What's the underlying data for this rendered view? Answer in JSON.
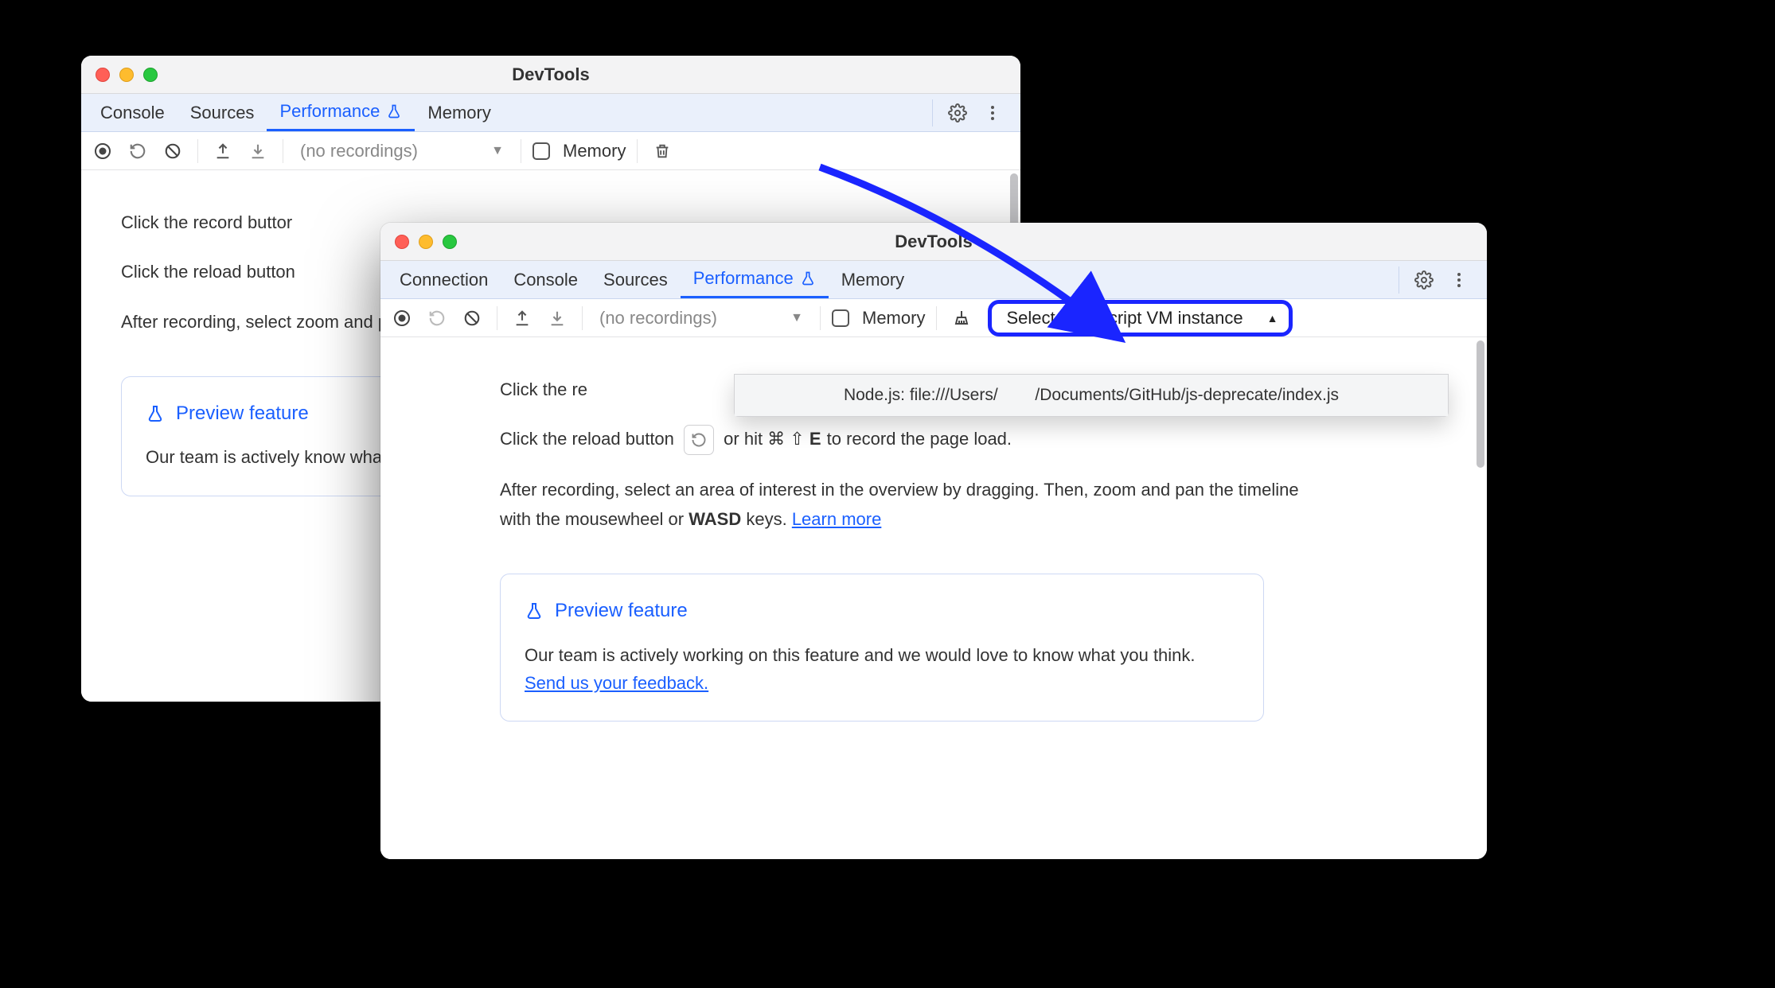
{
  "window_back": {
    "title": "DevTools",
    "tabs": [
      "Console",
      "Sources",
      "Performance",
      "Memory"
    ],
    "active_tab": "Performance",
    "toolbar": {
      "recordings_combo": "(no recordings)",
      "memory_label": "Memory"
    },
    "content": {
      "line1_prefix": "Click the record buttor",
      "line2_prefix": "Click the reload button",
      "line3": "After recording, select zoom and pan the tir",
      "preview_title": "Preview feature",
      "preview_body": "Our team is actively know what you thin"
    }
  },
  "window_front": {
    "title": "DevTools",
    "tabs": [
      "Connection",
      "Console",
      "Sources",
      "Performance",
      "Memory"
    ],
    "active_tab": "Performance",
    "toolbar": {
      "recordings_combo": "(no recordings)",
      "memory_label": "Memory",
      "vm_select_label": "Select JavaScript VM instance"
    },
    "vm_dropdown_option": "Node.js: file:///Users/        /Documents/GitHub/js-deprecate/index.js",
    "content": {
      "line1_prefix": "Click the re",
      "line2_prefix": "Click the reload button",
      "line2_suffix": "or hit ⌘ ⇧ ",
      "line2_key": "E",
      "line2_end": " to record the page load.",
      "line3_a": "After recording, select an area of interest in the overview by dragging. Then, zoom and pan the timeline with the mousewheel or ",
      "line3_wasd": "WASD",
      "line3_b": " keys. ",
      "learn_more": "Learn more",
      "preview_title": "Preview feature",
      "preview_body_a": "Our team is actively working on this feature and we would love to know what you think. ",
      "preview_link": "Send us your feedback."
    }
  }
}
